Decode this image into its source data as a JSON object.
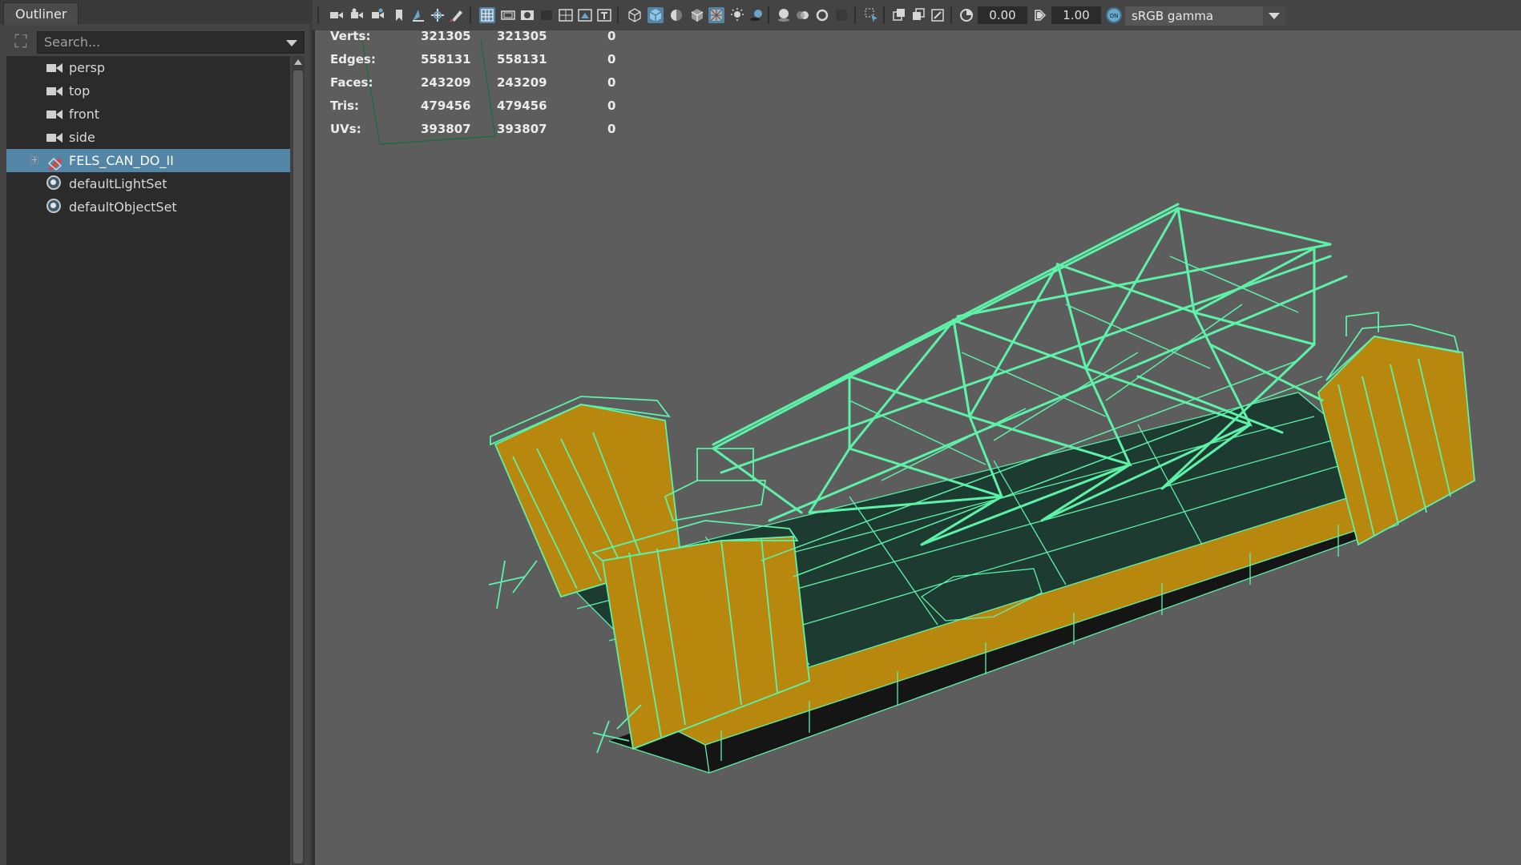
{
  "outliner": {
    "tab_label": "Outliner",
    "search_placeholder": "Search...",
    "items": [
      {
        "label": "persp",
        "icon": "camera-icon"
      },
      {
        "label": "top",
        "icon": "camera-icon"
      },
      {
        "label": "front",
        "icon": "camera-icon"
      },
      {
        "label": "side",
        "icon": "camera-icon"
      },
      {
        "label": "FELS_CAN_DO_II",
        "icon": "transform-icon",
        "selected": true
      },
      {
        "label": "defaultLightSet",
        "icon": "set-icon"
      },
      {
        "label": "defaultObjectSet",
        "icon": "set-icon"
      }
    ]
  },
  "toolbar": {
    "exposure_value": "0.00",
    "gamma_value": "1.00",
    "color_space": "sRGB gamma"
  },
  "hud": {
    "rows": [
      {
        "label": "Verts:",
        "c1": "321305",
        "c2": "321305",
        "c3": "0"
      },
      {
        "label": "Edges:",
        "c1": "558131",
        "c2": "558131",
        "c3": "0"
      },
      {
        "label": "Faces:",
        "c1": "243209",
        "c2": "243209",
        "c3": "0"
      },
      {
        "label": "Tris:",
        "c1": "479456",
        "c2": "479456",
        "c3": "0"
      },
      {
        "label": "UVs:",
        "c1": "393807",
        "c2": "393807",
        "c3": "0"
      }
    ]
  },
  "colors": {
    "wireframe": "#5df2a8",
    "hull_orange": "#b8870e",
    "deck": "#1d3b31",
    "selection": "#5285a6",
    "viewport_bg": "#5d5d5d"
  }
}
